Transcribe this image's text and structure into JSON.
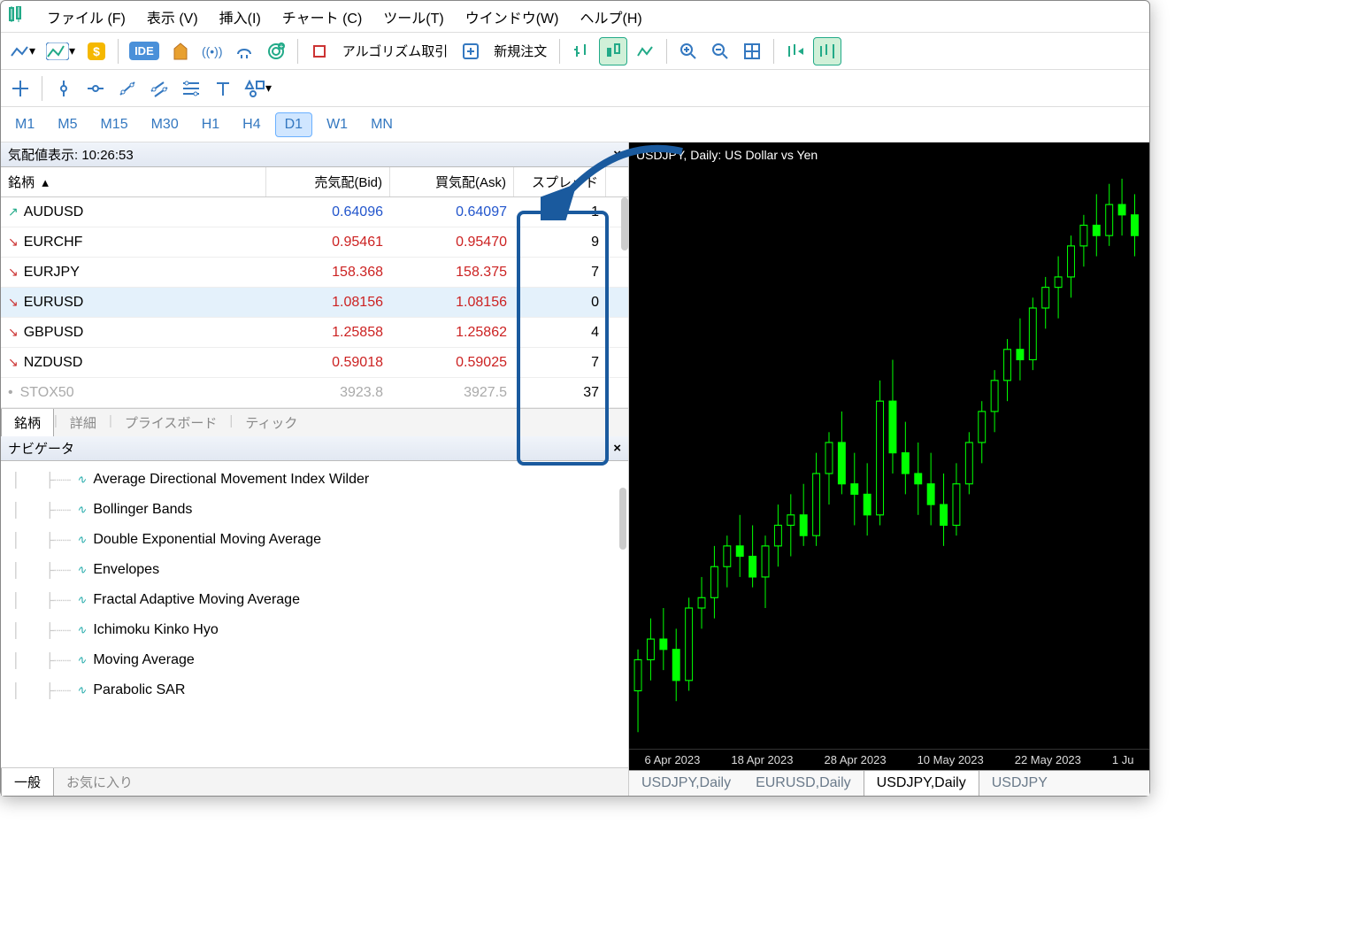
{
  "menu": {
    "file": "ファイル (F)",
    "view": "表示 (V)",
    "insert": "挿入(I)",
    "chart": "チャート (C)",
    "tools": "ツール(T)",
    "window": "ウインドウ(W)",
    "help": "ヘルプ(H)"
  },
  "toolbar2": {
    "algo": "アルゴリズム取引",
    "neworder": "新規注文"
  },
  "timeframes": [
    "M1",
    "M5",
    "M15",
    "M30",
    "H1",
    "H4",
    "D1",
    "W1",
    "MN"
  ],
  "tf_active": "D1",
  "marketwatch": {
    "title": "気配値表示: 10:26:53",
    "cols": {
      "symbol": "銘柄",
      "bid": "売気配(Bid)",
      "ask": "買気配(Ask)",
      "spread": "スプレッド"
    },
    "rows": [
      {
        "sym": "AUDUSD",
        "bid": "0.64096",
        "ask": "0.64097",
        "spr": "1",
        "dir": "up"
      },
      {
        "sym": "EURCHF",
        "bid": "0.95461",
        "ask": "0.95470",
        "spr": "9",
        "dir": "dn"
      },
      {
        "sym": "EURJPY",
        "bid": "158.368",
        "ask": "158.375",
        "spr": "7",
        "dir": "dn"
      },
      {
        "sym": "EURUSD",
        "bid": "1.08156",
        "ask": "1.08156",
        "spr": "0",
        "dir": "dn",
        "sel": true
      },
      {
        "sym": "GBPUSD",
        "bid": "1.25858",
        "ask": "1.25862",
        "spr": "4",
        "dir": "dn"
      },
      {
        "sym": "NZDUSD",
        "bid": "0.59018",
        "ask": "0.59025",
        "spr": "7",
        "dir": "dn"
      },
      {
        "sym": "STOX50",
        "bid": "3923.8",
        "ask": "3927.5",
        "spr": "37",
        "dir": "dot"
      }
    ],
    "tabs": [
      "銘柄",
      "詳細",
      "プライスボード",
      "ティック"
    ]
  },
  "navigator": {
    "title": "ナビゲータ",
    "items": [
      "Average Directional Movement Index Wilder",
      "Bollinger Bands",
      "Double Exponential Moving Average",
      "Envelopes",
      "Fractal Adaptive Moving Average",
      "Ichimoku Kinko Hyo",
      "Moving Average",
      "Parabolic SAR"
    ],
    "tabs": [
      "一般",
      "お気に入り"
    ]
  },
  "chart": {
    "title": "USDJPY, Daily: US Dollar vs Yen",
    "tabs": [
      "USDJPY,Daily",
      "EURUSD,Daily",
      "USDJPY,Daily",
      "USDJPY"
    ],
    "xticks": [
      "6 Apr 2023",
      "18 Apr 2023",
      "28 Apr 2023",
      "10 May 2023",
      "22 May 2023",
      "1 Ju"
    ]
  },
  "chart_data": {
    "type": "candlestick",
    "title": "USDJPY, Daily: US Dollar vs Yen",
    "xlabel_ticks": [
      "6 Apr 2023",
      "18 Apr 2023",
      "28 Apr 2023",
      "10 May 2023",
      "22 May 2023",
      "1 Ju"
    ],
    "ylim": [
      130,
      141
    ],
    "candles": [
      {
        "o": 131.0,
        "h": 131.8,
        "l": 130.2,
        "c": 131.6
      },
      {
        "o": 131.6,
        "h": 132.4,
        "l": 131.2,
        "c": 132.0
      },
      {
        "o": 132.0,
        "h": 132.6,
        "l": 131.4,
        "c": 131.8
      },
      {
        "o": 131.8,
        "h": 132.2,
        "l": 130.8,
        "c": 131.2
      },
      {
        "o": 131.2,
        "h": 132.8,
        "l": 131.0,
        "c": 132.6
      },
      {
        "o": 132.6,
        "h": 133.2,
        "l": 132.2,
        "c": 132.8
      },
      {
        "o": 132.8,
        "h": 133.8,
        "l": 132.4,
        "c": 133.4
      },
      {
        "o": 133.4,
        "h": 134.0,
        "l": 133.0,
        "c": 133.8
      },
      {
        "o": 133.8,
        "h": 134.4,
        "l": 133.2,
        "c": 133.6
      },
      {
        "o": 133.6,
        "h": 134.2,
        "l": 133.0,
        "c": 133.2
      },
      {
        "o": 133.2,
        "h": 134.0,
        "l": 132.6,
        "c": 133.8
      },
      {
        "o": 133.8,
        "h": 134.6,
        "l": 133.4,
        "c": 134.2
      },
      {
        "o": 134.2,
        "h": 134.8,
        "l": 133.6,
        "c": 134.4
      },
      {
        "o": 134.4,
        "h": 135.0,
        "l": 133.8,
        "c": 134.0
      },
      {
        "o": 134.0,
        "h": 135.6,
        "l": 133.8,
        "c": 135.2
      },
      {
        "o": 135.2,
        "h": 136.0,
        "l": 134.6,
        "c": 135.8
      },
      {
        "o": 135.8,
        "h": 136.4,
        "l": 134.8,
        "c": 135.0
      },
      {
        "o": 135.0,
        "h": 135.6,
        "l": 134.2,
        "c": 134.8
      },
      {
        "o": 134.8,
        "h": 135.4,
        "l": 134.0,
        "c": 134.4
      },
      {
        "o": 134.4,
        "h": 137.0,
        "l": 134.2,
        "c": 136.6
      },
      {
        "o": 136.6,
        "h": 137.4,
        "l": 135.2,
        "c": 135.6
      },
      {
        "o": 135.6,
        "h": 136.2,
        "l": 134.8,
        "c": 135.2
      },
      {
        "o": 135.2,
        "h": 135.8,
        "l": 134.4,
        "c": 135.0
      },
      {
        "o": 135.0,
        "h": 135.6,
        "l": 134.2,
        "c": 134.6
      },
      {
        "o": 134.6,
        "h": 135.2,
        "l": 133.8,
        "c": 134.2
      },
      {
        "o": 134.2,
        "h": 135.4,
        "l": 134.0,
        "c": 135.0
      },
      {
        "o": 135.0,
        "h": 136.0,
        "l": 134.8,
        "c": 135.8
      },
      {
        "o": 135.8,
        "h": 136.6,
        "l": 135.4,
        "c": 136.4
      },
      {
        "o": 136.4,
        "h": 137.2,
        "l": 136.0,
        "c": 137.0
      },
      {
        "o": 137.0,
        "h": 137.8,
        "l": 136.6,
        "c": 137.6
      },
      {
        "o": 137.6,
        "h": 138.2,
        "l": 137.0,
        "c": 137.4
      },
      {
        "o": 137.4,
        "h": 138.6,
        "l": 137.2,
        "c": 138.4
      },
      {
        "o": 138.4,
        "h": 139.0,
        "l": 138.0,
        "c": 138.8
      },
      {
        "o": 138.8,
        "h": 139.4,
        "l": 138.2,
        "c": 139.0
      },
      {
        "o": 139.0,
        "h": 139.8,
        "l": 138.6,
        "c": 139.6
      },
      {
        "o": 139.6,
        "h": 140.2,
        "l": 139.2,
        "c": 140.0
      },
      {
        "o": 140.0,
        "h": 140.6,
        "l": 139.4,
        "c": 139.8
      },
      {
        "o": 139.8,
        "h": 140.8,
        "l": 139.6,
        "c": 140.4
      },
      {
        "o": 140.4,
        "h": 140.9,
        "l": 139.8,
        "c": 140.2
      },
      {
        "o": 140.2,
        "h": 140.6,
        "l": 139.4,
        "c": 139.8
      }
    ]
  }
}
